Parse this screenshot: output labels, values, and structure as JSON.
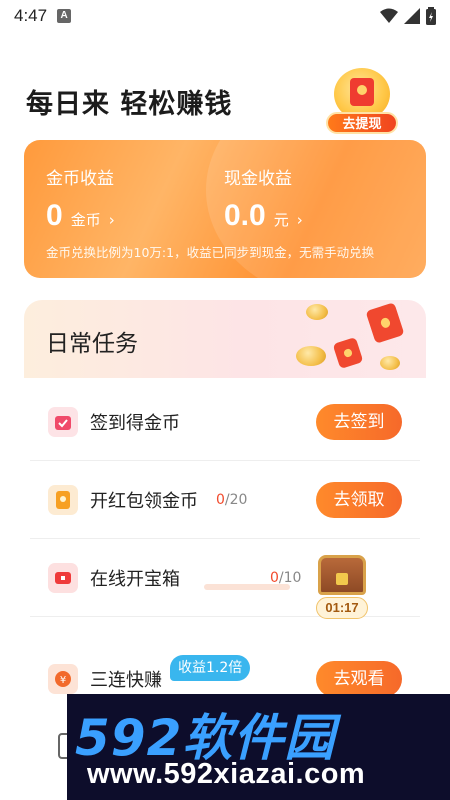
{
  "status_bar": {
    "time": "4:47",
    "notif_icon": "A"
  },
  "header": {
    "title": "每日来 轻松赚钱",
    "withdraw_label": "去提现"
  },
  "earnings": {
    "coin": {
      "caption": "金币收益",
      "value": "0",
      "unit": "金币",
      "arrow": "›"
    },
    "cash": {
      "caption": "现金收益",
      "value": "0.0",
      "unit": "元",
      "arrow": "›"
    },
    "note": "金币兑换比例为10万:1，收益已同步到现金，无需手动兑换"
  },
  "daily": {
    "title": "日常任务",
    "tasks": [
      {
        "label": "签到得金币",
        "count_current": "",
        "count_rest": "",
        "button": "去签到"
      },
      {
        "label": "开红包领金币",
        "count_current": "0",
        "count_rest": "/20",
        "button": "去领取"
      },
      {
        "label": "在线开宝箱",
        "count_current": "0",
        "count_rest": "/10",
        "button": ""
      },
      {
        "label": "三连快赚",
        "count_current": "",
        "count_rest": "",
        "button": "去观看"
      }
    ],
    "chest_timer": "01:17",
    "bonus_tag": "收益1.2倍",
    "online_progress": 0
  },
  "watermark": {
    "top": "592软件园",
    "bottom": "www.592xiazai.com"
  },
  "colors": {
    "accent_orange": "#f6692a",
    "count_red": "#f24a2c",
    "bonus_blue": "#39b6ee"
  },
  "icons": [
    "wifi-icon",
    "signal-icon",
    "battery-icon",
    "calendar-icon",
    "red-envelope-icon",
    "treasure-chest-icon",
    "coin-icon"
  ]
}
